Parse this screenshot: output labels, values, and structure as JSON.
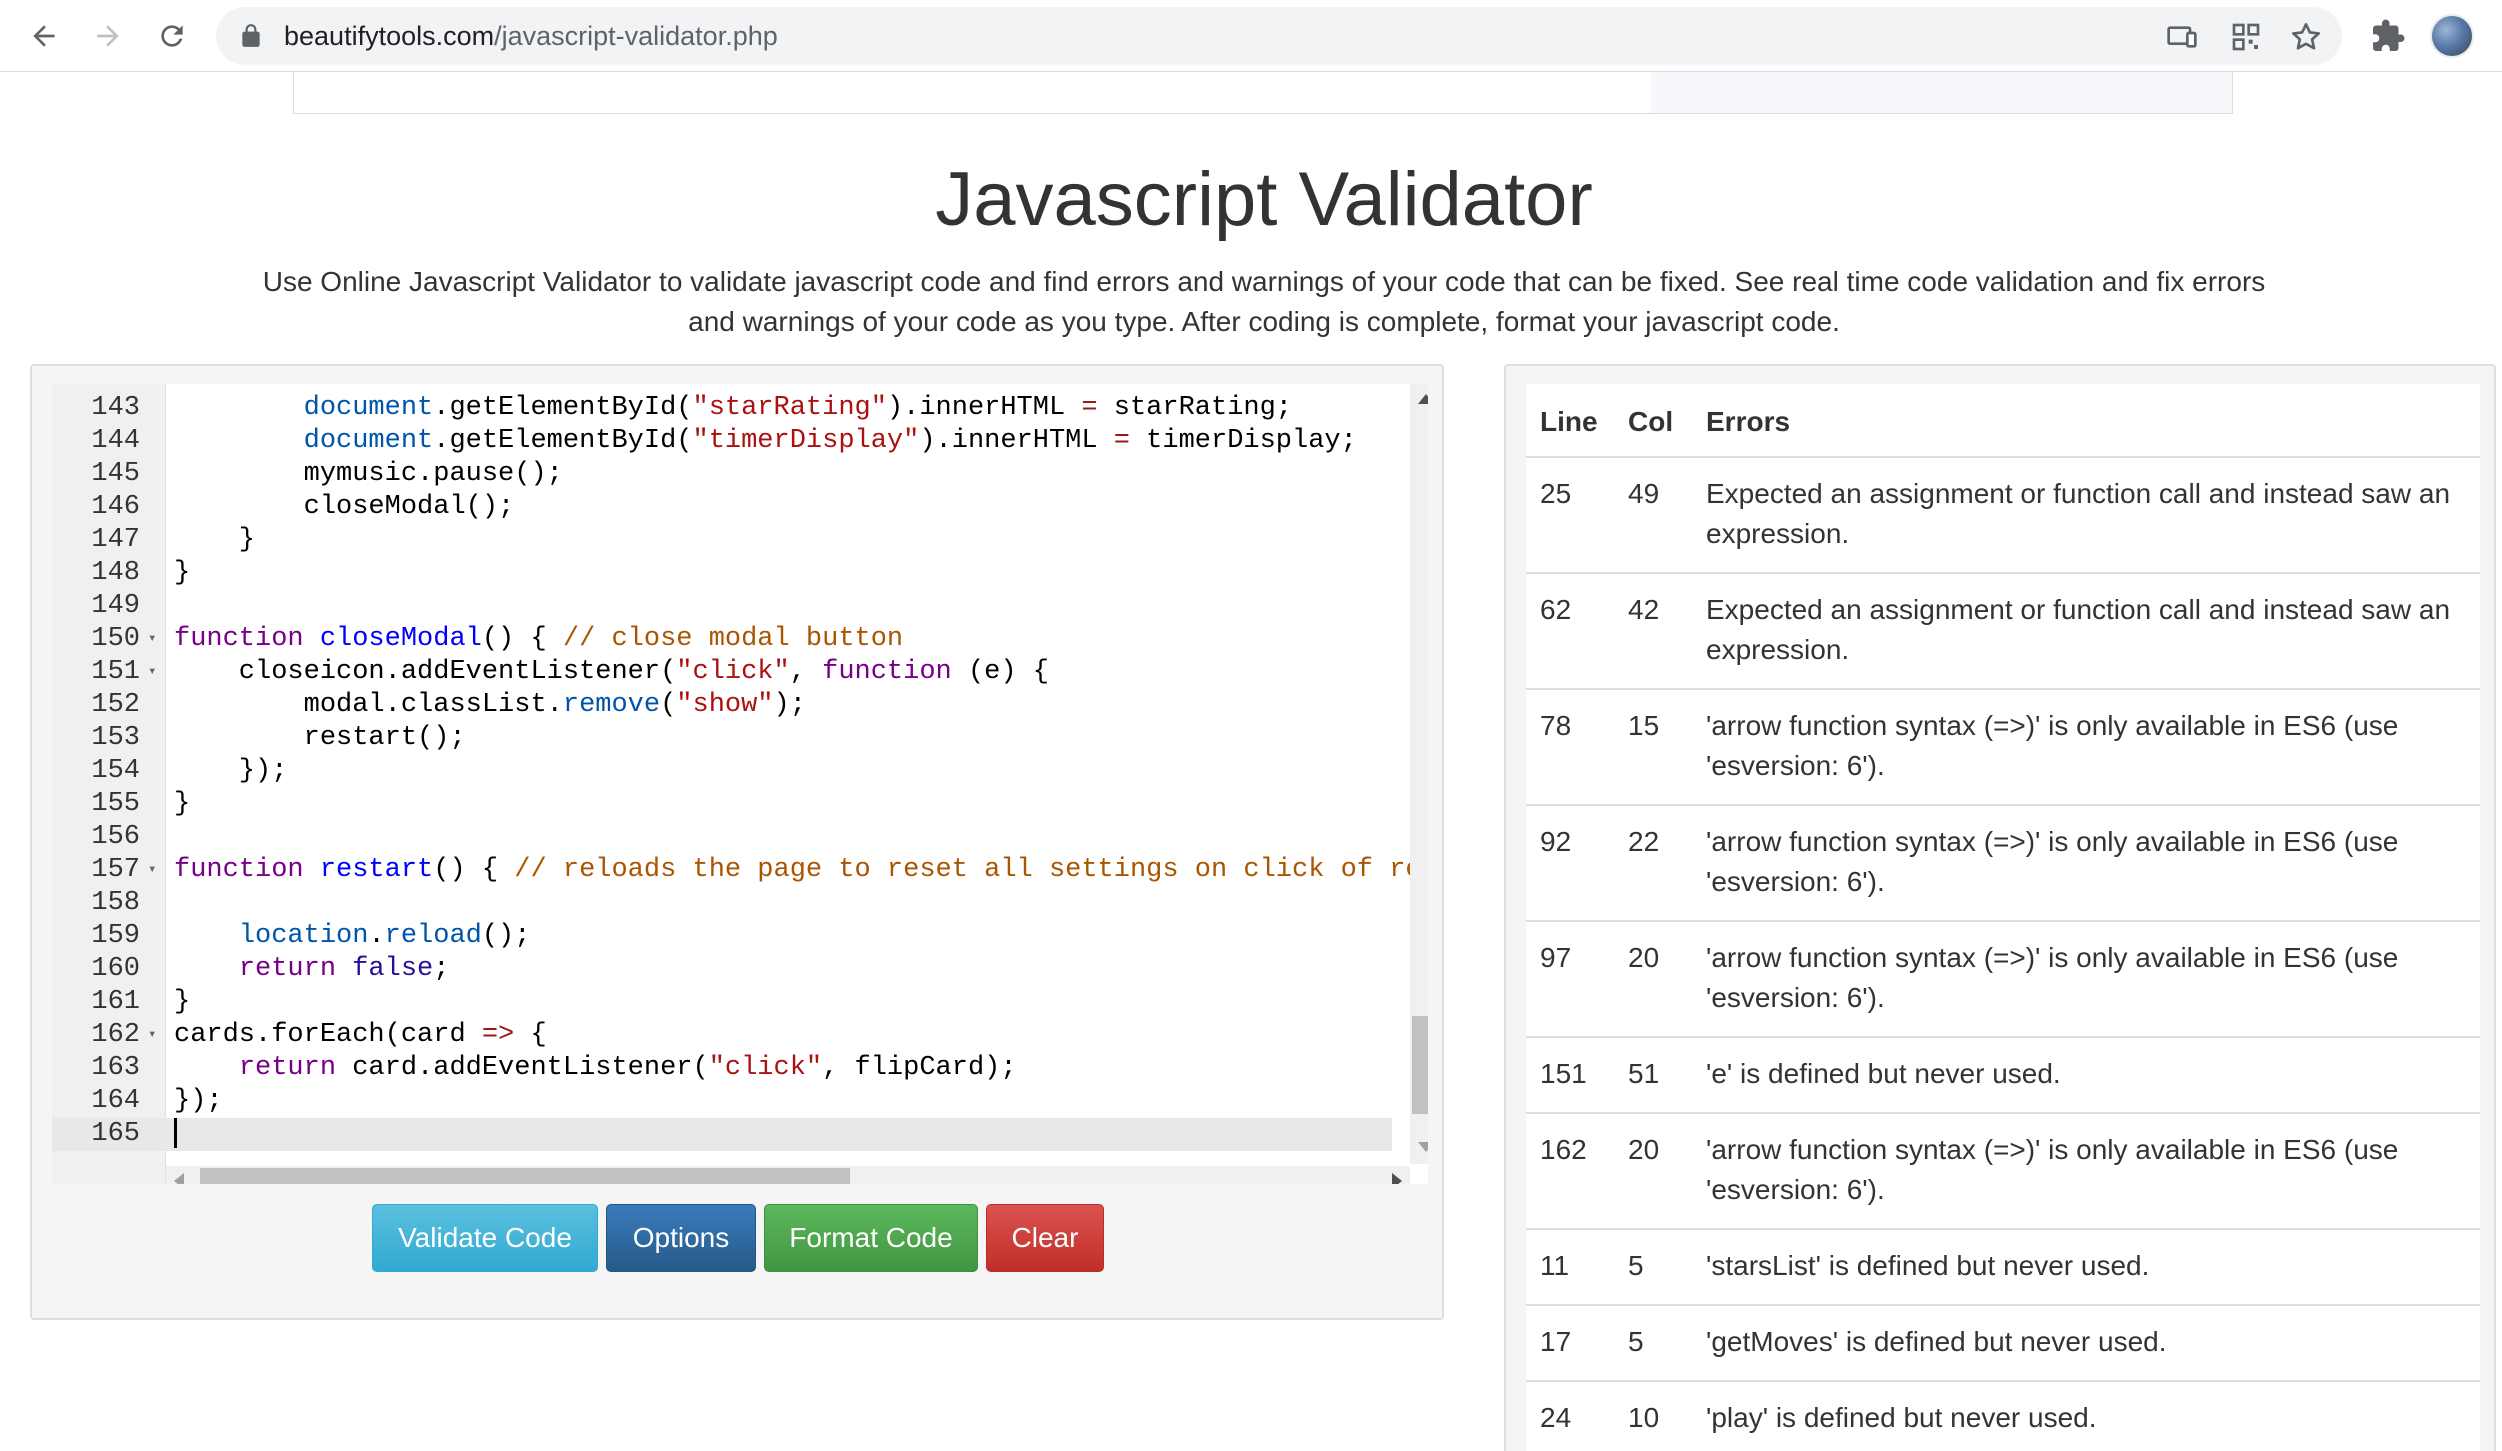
{
  "browser": {
    "url_domain": "beautifytools.com",
    "url_path": "/javascript-validator.php"
  },
  "header": {
    "title": "Javascript Validator",
    "description": "Use Online Javascript Validator to validate javascript code and find errors and warnings of your code that can be fixed. See real time code validation and fix errors and warnings of your code as you type. After coding is complete, format your javascript code."
  },
  "editor": {
    "lines": [
      {
        "n": "143",
        "fold": false,
        "html": "        <span class=\"var2\">document</span>.<span class=\"prop\">getElementById</span>(<span class=\"str\">\"starRating\"</span>).<span class=\"prop\">innerHTML</span> <span class=\"op\">=</span> starRating;"
      },
      {
        "n": "144",
        "fold": false,
        "html": "        <span class=\"var2\">document</span>.<span class=\"prop\">getElementById</span>(<span class=\"str\">\"timerDisplay\"</span>).<span class=\"prop\">innerHTML</span> <span class=\"op\">=</span> timerDisplay;"
      },
      {
        "n": "145",
        "fold": false,
        "html": "        mymusic.<span class=\"prop\">pause</span>();"
      },
      {
        "n": "146",
        "fold": false,
        "html": "        closeModal();"
      },
      {
        "n": "147",
        "fold": false,
        "html": "    }"
      },
      {
        "n": "148",
        "fold": false,
        "html": "}"
      },
      {
        "n": "149",
        "fold": false,
        "html": ""
      },
      {
        "n": "150",
        "fold": true,
        "html": "<span class=\"kw\">function</span> <span class=\"def\">closeModal</span>() { <span class=\"cm\">// close modal button</span>"
      },
      {
        "n": "151",
        "fold": true,
        "html": "    closeicon.<span class=\"prop\">addEventListener</span>(<span class=\"str\">\"click\"</span>, <span class=\"kw\">function</span> (e) {"
      },
      {
        "n": "152",
        "fold": false,
        "html": "        modal.<span class=\"prop\">classList</span>.<span class=\"var2\">remove</span>(<span class=\"str\">\"show\"</span>);"
      },
      {
        "n": "153",
        "fold": false,
        "html": "        restart();"
      },
      {
        "n": "154",
        "fold": false,
        "html": "    });"
      },
      {
        "n": "155",
        "fold": false,
        "html": "}"
      },
      {
        "n": "156",
        "fold": false,
        "html": ""
      },
      {
        "n": "157",
        "fold": true,
        "html": "<span class=\"kw\">function</span> <span class=\"def\">restart</span>() { <span class=\"cm\">// reloads the page to reset all settings on click of rest</span>"
      },
      {
        "n": "158",
        "fold": false,
        "html": ""
      },
      {
        "n": "159",
        "fold": false,
        "html": "    <span class=\"var2\">location</span>.<span class=\"var2\">reload</span>();"
      },
      {
        "n": "160",
        "fold": false,
        "html": "    <span class=\"kw\">return</span> <span class=\"dkw\">false</span>;"
      },
      {
        "n": "161",
        "fold": false,
        "html": "}"
      },
      {
        "n": "162",
        "fold": true,
        "html": "cards.<span class=\"prop\">forEach</span>(card <span class=\"op\">=&gt;</span> {"
      },
      {
        "n": "163",
        "fold": false,
        "html": "    <span class=\"kw\">return</span> card.<span class=\"prop\">addEventListener</span>(<span class=\"str\">\"click\"</span>, flipCard);"
      },
      {
        "n": "164",
        "fold": false,
        "html": "});"
      },
      {
        "n": "165",
        "fold": false,
        "html": "<span class=\"cursor\"></span>",
        "active": true
      }
    ]
  },
  "buttons": {
    "validate": "Validate Code",
    "options": "Options",
    "format": "Format Code",
    "clear": "Clear"
  },
  "errors": {
    "headers": {
      "line": "Line",
      "col": "Col",
      "errors": "Errors"
    },
    "rows": [
      {
        "line": "25",
        "col": "49",
        "message": "Expected an assignment or function call and instead saw an expression."
      },
      {
        "line": "62",
        "col": "42",
        "message": "Expected an assignment or function call and instead saw an expression."
      },
      {
        "line": "78",
        "col": "15",
        "message": "'arrow function syntax (=>)' is only available in ES6 (use 'esversion: 6')."
      },
      {
        "line": "92",
        "col": "22",
        "message": "'arrow function syntax (=>)' is only available in ES6 (use 'esversion: 6')."
      },
      {
        "line": "97",
        "col": "20",
        "message": "'arrow function syntax (=>)' is only available in ES6 (use 'esversion: 6')."
      },
      {
        "line": "151",
        "col": "51",
        "message": "'e' is defined but never used."
      },
      {
        "line": "162",
        "col": "20",
        "message": "'arrow function syntax (=>)' is only available in ES6 (use 'esversion: 6')."
      },
      {
        "line": "11",
        "col": "5",
        "message": "'starsList' is defined but never used."
      },
      {
        "line": "17",
        "col": "5",
        "message": "'getMoves' is defined but never used."
      },
      {
        "line": "24",
        "col": "10",
        "message": "'play' is defined but never used."
      }
    ]
  },
  "icons": {
    "back": "back-arrow-icon",
    "forward": "forward-arrow-icon",
    "reload": "reload-icon",
    "lock": "lock-icon",
    "cast": "cast-icon",
    "qr": "qr-code-icon",
    "bookmark": "star-icon",
    "extensions": "puzzle-icon"
  },
  "colors": {
    "validate": "#31a9d2",
    "options": "#265a88",
    "format": "#419641",
    "clear": "#c12e2a"
  }
}
